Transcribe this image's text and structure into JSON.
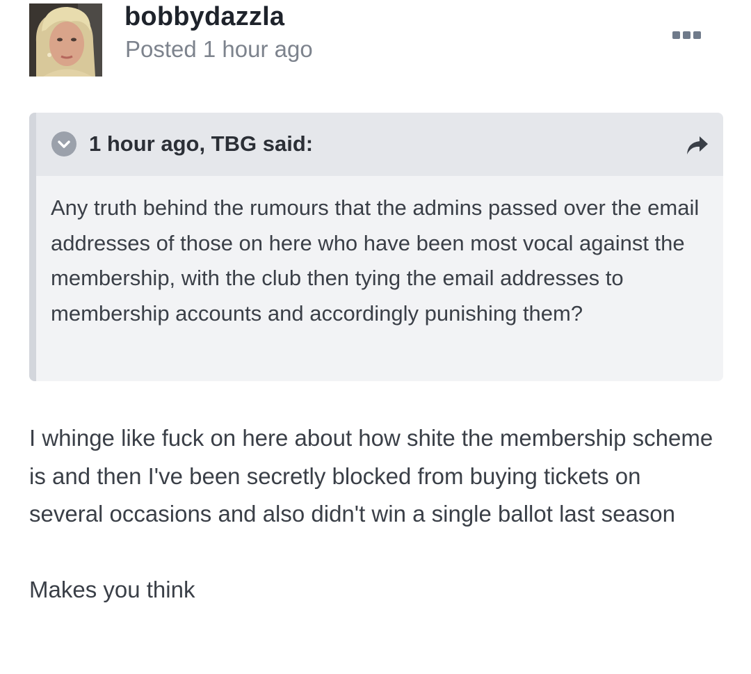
{
  "post": {
    "author": "bobbydazzla",
    "posted": "Posted 1 hour ago",
    "avatar_icon": "user-avatar-photo"
  },
  "quote": {
    "cite": "1 hour ago, TBG said:",
    "body": "Any truth behind the rumours that the admins passed over the email addresses of those on here who have been most vocal against the membership, with the club then tying the email addresses to membership accounts and accordingly punishing them?"
  },
  "body": {
    "paragraph_1": "I whinge like fuck on here about how shite the membership scheme is and then I've been secretly blocked from buying tickets on several occasions and also didn't win a single ballot last season",
    "paragraph_2": "Makes you think"
  },
  "icons": {
    "menu": "more-options-icon",
    "expand": "chevron-down-icon",
    "share": "share-arrow-icon"
  },
  "colors": {
    "quote_background": "#f2f3f5",
    "quote_header": "#e5e7eb",
    "quote_bar": "#d3d6dc",
    "muted_text": "#7d838d"
  }
}
